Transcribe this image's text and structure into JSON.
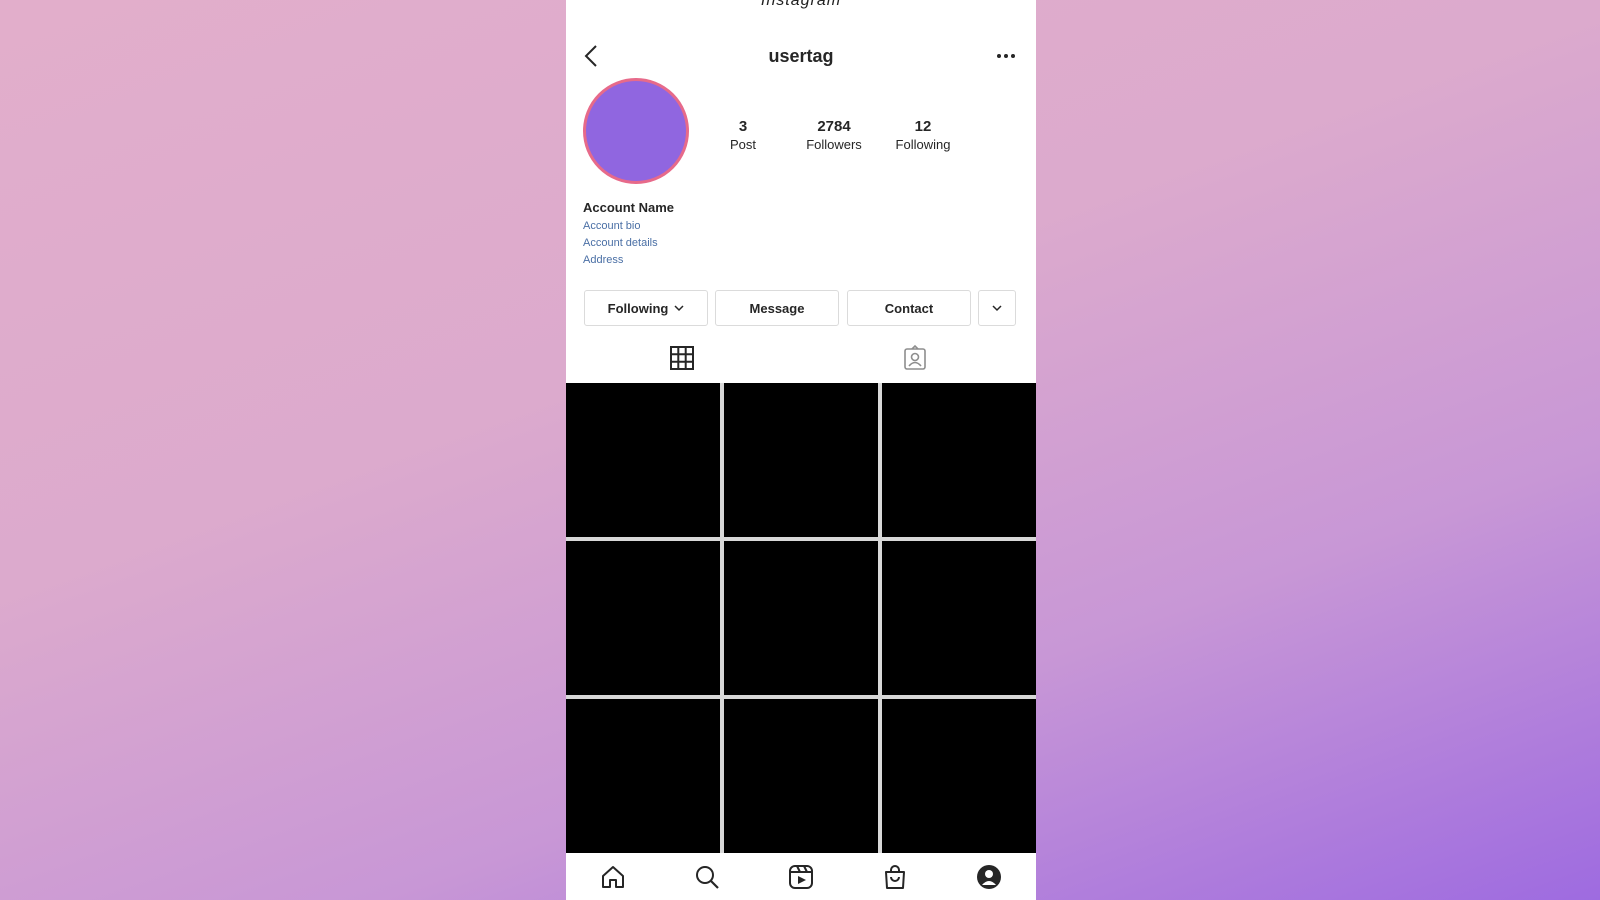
{
  "header": {
    "partial_title": "Instagram",
    "username": "usertag"
  },
  "profile": {
    "avatar_color": "#9066e0",
    "avatar_ring_color": "#e76a8a",
    "stats": {
      "posts": {
        "value": "3",
        "label": "Post"
      },
      "followers": {
        "value": "2784",
        "label": "Followers"
      },
      "following": {
        "value": "12",
        "label": "Following"
      }
    },
    "name": "Account Name",
    "bio_lines": [
      "Account bio",
      "Account details",
      "Address"
    ]
  },
  "actions": {
    "following_label": "Following",
    "message_label": "Message",
    "contact_label": "Contact"
  },
  "tabs": [
    {
      "icon": "grid-icon",
      "active": true
    },
    {
      "icon": "tagged-icon",
      "active": false
    }
  ],
  "posts": {
    "count": 9,
    "color": "#000000"
  },
  "bottom_nav": [
    "home-icon",
    "search-icon",
    "reels-icon",
    "shop-icon",
    "profile-icon"
  ]
}
